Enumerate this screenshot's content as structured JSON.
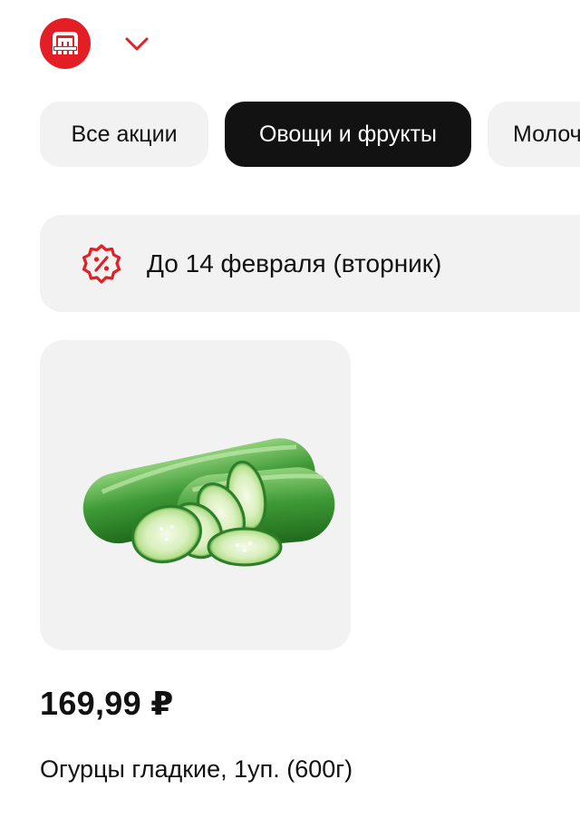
{
  "header": {
    "logo_icon": "magnit-logo-icon",
    "logo_letter": "М",
    "chevron_icon": "chevron-down-icon",
    "brand_color": "#e31e24"
  },
  "categories": [
    {
      "label": "Все акции",
      "active": false
    },
    {
      "label": "Овощи и фрукты",
      "active": true
    },
    {
      "label": "Молоч",
      "active": false
    }
  ],
  "period": {
    "icon": "discount-badge-icon",
    "text": "До 14 февраля (вторник)"
  },
  "product": {
    "image": "cucumber-image",
    "price": "169,99 ₽",
    "title": "Огурцы гладкие, 1уп. (600г)"
  }
}
